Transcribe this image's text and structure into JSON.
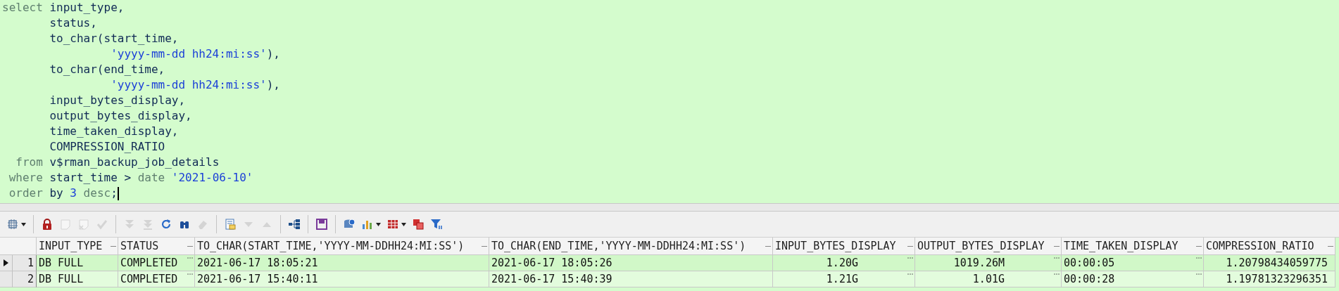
{
  "editor": {
    "lines": [
      {
        "cursor": false,
        "tokens": [
          {
            "kind": "keyword",
            "text": "select "
          },
          {
            "kind": "ident",
            "text": "input_type,"
          }
        ]
      },
      {
        "cursor": false,
        "tokens": [
          {
            "kind": "ident",
            "text": "       status,"
          }
        ]
      },
      {
        "cursor": false,
        "tokens": [
          {
            "kind": "ident",
            "text": "       to_char(start_time,"
          }
        ]
      },
      {
        "cursor": false,
        "tokens": [
          {
            "kind": "string",
            "text": "                'yyyy-mm-dd hh24:mi:ss'"
          },
          {
            "kind": "ident",
            "text": "),"
          }
        ]
      },
      {
        "cursor": false,
        "tokens": [
          {
            "kind": "ident",
            "text": "       to_char(end_time,"
          }
        ]
      },
      {
        "cursor": false,
        "tokens": [
          {
            "kind": "string",
            "text": "                'yyyy-mm-dd hh24:mi:ss'"
          },
          {
            "kind": "ident",
            "text": "),"
          }
        ]
      },
      {
        "cursor": false,
        "tokens": [
          {
            "kind": "ident",
            "text": "       input_bytes_display,"
          }
        ]
      },
      {
        "cursor": false,
        "tokens": [
          {
            "kind": "ident",
            "text": "       output_bytes_display,"
          }
        ]
      },
      {
        "cursor": false,
        "tokens": [
          {
            "kind": "ident",
            "text": "       time_taken_display,"
          }
        ]
      },
      {
        "cursor": false,
        "tokens": [
          {
            "kind": "ident",
            "text": "       COMPRESSION_RATIO"
          }
        ]
      },
      {
        "cursor": false,
        "tokens": [
          {
            "kind": "keyword",
            "text": "  from "
          },
          {
            "kind": "ident",
            "text": "v$rman_backup_job_details"
          }
        ]
      },
      {
        "cursor": false,
        "tokens": [
          {
            "kind": "keyword",
            "text": " where "
          },
          {
            "kind": "ident",
            "text": "start_time > "
          },
          {
            "kind": "keyword",
            "text": "date "
          },
          {
            "kind": "string",
            "text": "'2021-06-10'"
          }
        ]
      },
      {
        "cursor": true,
        "tokens": [
          {
            "kind": "keyword",
            "text": " order "
          },
          {
            "kind": "ident",
            "text": "by "
          },
          {
            "kind": "string",
            "text": "3 "
          },
          {
            "kind": "keyword",
            "text": "desc"
          },
          {
            "kind": "ident",
            "text": ";"
          }
        ]
      }
    ]
  },
  "toolbar": [
    {
      "kind": "grid",
      "disabled": false,
      "dropdown": true
    },
    {
      "kind": "separator"
    },
    {
      "kind": "lock",
      "disabled": false
    },
    {
      "kind": "note",
      "disabled": true
    },
    {
      "kind": "note-x",
      "disabled": true
    },
    {
      "kind": "check",
      "disabled": true
    },
    {
      "kind": "separator"
    },
    {
      "kind": "double-down",
      "disabled": true
    },
    {
      "kind": "down-line",
      "disabled": true
    },
    {
      "kind": "refresh",
      "disabled": false
    },
    {
      "kind": "binoculars",
      "disabled": false
    },
    {
      "kind": "eraser",
      "disabled": true
    },
    {
      "kind": "separator"
    },
    {
      "kind": "form",
      "disabled": false
    },
    {
      "kind": "tri-down",
      "disabled": true
    },
    {
      "kind": "tri-up",
      "disabled": true
    },
    {
      "kind": "separator"
    },
    {
      "kind": "tree",
      "disabled": false
    },
    {
      "kind": "separator"
    },
    {
      "kind": "save",
      "disabled": false
    },
    {
      "kind": "separator"
    },
    {
      "kind": "db",
      "disabled": false
    },
    {
      "kind": "chart",
      "disabled": false,
      "dropdown": true
    },
    {
      "kind": "table",
      "disabled": false,
      "dropdown": true
    },
    {
      "kind": "copy",
      "disabled": false
    },
    {
      "kind": "filter",
      "disabled": false
    }
  ],
  "grid": {
    "columns": [
      {
        "label": "INPUT_TYPE",
        "kind": "text",
        "editor": false
      },
      {
        "label": "STATUS",
        "kind": "text",
        "editor": true
      },
      {
        "label": "TO_CHAR(START_TIME,'YYYY-MM-DDHH24:MI:SS')",
        "kind": "text",
        "editor": false
      },
      {
        "label": "TO_CHAR(END_TIME,'YYYY-MM-DDHH24:MI:SS')",
        "kind": "text",
        "editor": false
      },
      {
        "label": "INPUT_BYTES_DISPLAY",
        "kind": "number",
        "editor": true
      },
      {
        "label": "OUTPUT_BYTES_DISPLAY",
        "kind": "number",
        "editor": true
      },
      {
        "label": "TIME_TAKEN_DISPLAY",
        "kind": "text",
        "editor": true
      },
      {
        "label": "COMPRESSION_RATIO",
        "kind": "number",
        "editor": false
      }
    ],
    "rows": [
      {
        "number": "1",
        "selected": true,
        "cells": [
          "DB FULL",
          "COMPLETED",
          "2021-06-17 18:05:21",
          "2021-06-17 18:05:26",
          "1.20G",
          "1019.26M",
          "00:00:05",
          "1.20798434059775"
        ]
      },
      {
        "number": "2",
        "selected": false,
        "cells": [
          "DB FULL",
          "COMPLETED",
          "2021-06-17 15:40:11",
          "2021-06-17 15:40:39",
          "1.21G",
          "1.01G",
          "00:00:28",
          "1.19781323296351"
        ]
      }
    ]
  }
}
